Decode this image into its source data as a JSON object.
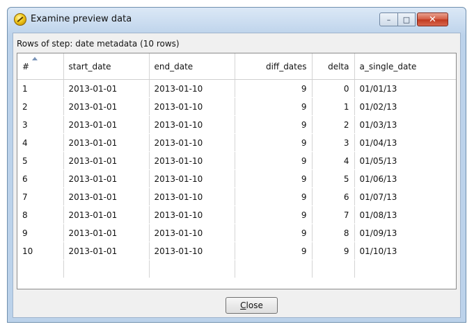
{
  "window": {
    "title": "Examine preview data",
    "controls": {
      "minimize": "–",
      "maximize": "□",
      "close": "✕"
    }
  },
  "caption": "Rows of step: date metadata (10 rows)",
  "table": {
    "columns": [
      "#",
      "start_date",
      "end_date",
      "diff_dates",
      "delta",
      "a_single_date"
    ],
    "rows": [
      [
        "1",
        "2013-01-01",
        "2013-01-10",
        "9",
        "0",
        "01/01/13"
      ],
      [
        "2",
        "2013-01-01",
        "2013-01-10",
        "9",
        "1",
        "01/02/13"
      ],
      [
        "3",
        "2013-01-01",
        "2013-01-10",
        "9",
        "2",
        "01/03/13"
      ],
      [
        "4",
        "2013-01-01",
        "2013-01-10",
        "9",
        "3",
        "01/04/13"
      ],
      [
        "5",
        "2013-01-01",
        "2013-01-10",
        "9",
        "4",
        "01/05/13"
      ],
      [
        "6",
        "2013-01-01",
        "2013-01-10",
        "9",
        "5",
        "01/06/13"
      ],
      [
        "7",
        "2013-01-01",
        "2013-01-10",
        "9",
        "6",
        "01/07/13"
      ],
      [
        "8",
        "2013-01-01",
        "2013-01-10",
        "9",
        "7",
        "01/08/13"
      ],
      [
        "9",
        "2013-01-01",
        "2013-01-10",
        "9",
        "8",
        "01/09/13"
      ],
      [
        "10",
        "2013-01-01",
        "2013-01-10",
        "9",
        "9",
        "01/10/13"
      ]
    ]
  },
  "close_button": {
    "mnemonic": "C",
    "rest": "lose"
  }
}
